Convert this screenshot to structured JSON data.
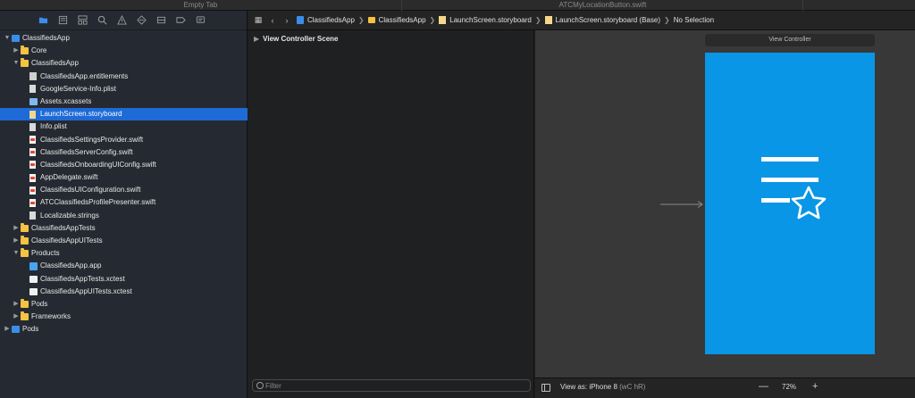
{
  "tabs": [
    {
      "label": "Empty Tab"
    },
    {
      "label": "ATCMyLocationButton.swift"
    },
    {
      "label": ""
    }
  ],
  "navigator": {
    "toolbar_icons": [
      "folder-icon",
      "source-control-icon",
      "hierarchy-icon",
      "search-icon",
      "warning-icon",
      "test-icon",
      "debug-icon",
      "breakpoint-icon",
      "report-icon"
    ],
    "tree": [
      {
        "label": "ClassifiedsApp",
        "level": 0,
        "disclosure": "open",
        "icon": "proj"
      },
      {
        "label": "Core",
        "level": 1,
        "disclosure": "closed",
        "icon": "folder"
      },
      {
        "label": "ClassifiedsApp",
        "level": 1,
        "disclosure": "open",
        "icon": "folder"
      },
      {
        "label": "ClassifiedsApp.entitlements",
        "level": 2,
        "disclosure": "",
        "icon": "ent"
      },
      {
        "label": "GoogleService-Info.plist",
        "level": 2,
        "disclosure": "",
        "icon": "plist"
      },
      {
        "label": "Assets.xcassets",
        "level": 2,
        "disclosure": "",
        "icon": "assets"
      },
      {
        "label": "LaunchScreen.storyboard",
        "level": 2,
        "disclosure": "",
        "icon": "story",
        "selected": true
      },
      {
        "label": "Info.plist",
        "level": 2,
        "disclosure": "",
        "icon": "plist"
      },
      {
        "label": "ClassifiedsSettingsProvider.swift",
        "level": 2,
        "disclosure": "",
        "icon": "swift"
      },
      {
        "label": "ClassifiedsServerConfig.swift",
        "level": 2,
        "disclosure": "",
        "icon": "swift"
      },
      {
        "label": "ClassifiedsOnboardingUIConfig.swift",
        "level": 2,
        "disclosure": "",
        "icon": "swift"
      },
      {
        "label": "AppDelegate.swift",
        "level": 2,
        "disclosure": "",
        "icon": "swift"
      },
      {
        "label": "ClassifiedsUIConfiguration.swift",
        "level": 2,
        "disclosure": "",
        "icon": "swift"
      },
      {
        "label": "ATCClassifiedsProfilePresenter.swift",
        "level": 2,
        "disclosure": "",
        "icon": "swift"
      },
      {
        "label": "Localizable.strings",
        "level": 2,
        "disclosure": "",
        "icon": "strings"
      },
      {
        "label": "ClassifiedsAppTests",
        "level": 1,
        "disclosure": "closed",
        "icon": "folder"
      },
      {
        "label": "ClassifiedsAppUITests",
        "level": 1,
        "disclosure": "closed",
        "icon": "folder"
      },
      {
        "label": "Products",
        "level": 1,
        "disclosure": "open",
        "icon": "folder"
      },
      {
        "label": "ClassifiedsApp.app",
        "level": 2,
        "disclosure": "",
        "icon": "app"
      },
      {
        "label": "ClassifiedsAppTests.xctest",
        "level": 2,
        "disclosure": "",
        "icon": "xctest"
      },
      {
        "label": "ClassifiedsAppUITests.xctest",
        "level": 2,
        "disclosure": "",
        "icon": "xctest"
      },
      {
        "label": "Pods",
        "level": 1,
        "disclosure": "closed",
        "icon": "folder"
      },
      {
        "label": "Frameworks",
        "level": 1,
        "disclosure": "closed",
        "icon": "folder"
      },
      {
        "label": "Pods",
        "level": 0,
        "disclosure": "closed",
        "icon": "proj"
      }
    ]
  },
  "jumpbar": {
    "crumbs": [
      {
        "label": "ClassifiedsApp",
        "icon": "proj"
      },
      {
        "label": "ClassifiedsApp",
        "icon": "folder"
      },
      {
        "label": "LaunchScreen.storyboard",
        "icon": "story"
      },
      {
        "label": "LaunchScreen.storyboard (Base)",
        "icon": "story"
      },
      {
        "label": "No Selection",
        "icon": ""
      }
    ]
  },
  "outline": {
    "scene_label": "View Controller Scene",
    "filter_placeholder": "Filter"
  },
  "canvas": {
    "vc_title": "View Controller",
    "screen_color": "#0a96e6"
  },
  "bottombar": {
    "view_as": "View as: iPhone 8",
    "view_as_modifiers": "(wC hR)",
    "zoom_minus": "—",
    "zoom_level": "72%",
    "zoom_plus": "+"
  }
}
